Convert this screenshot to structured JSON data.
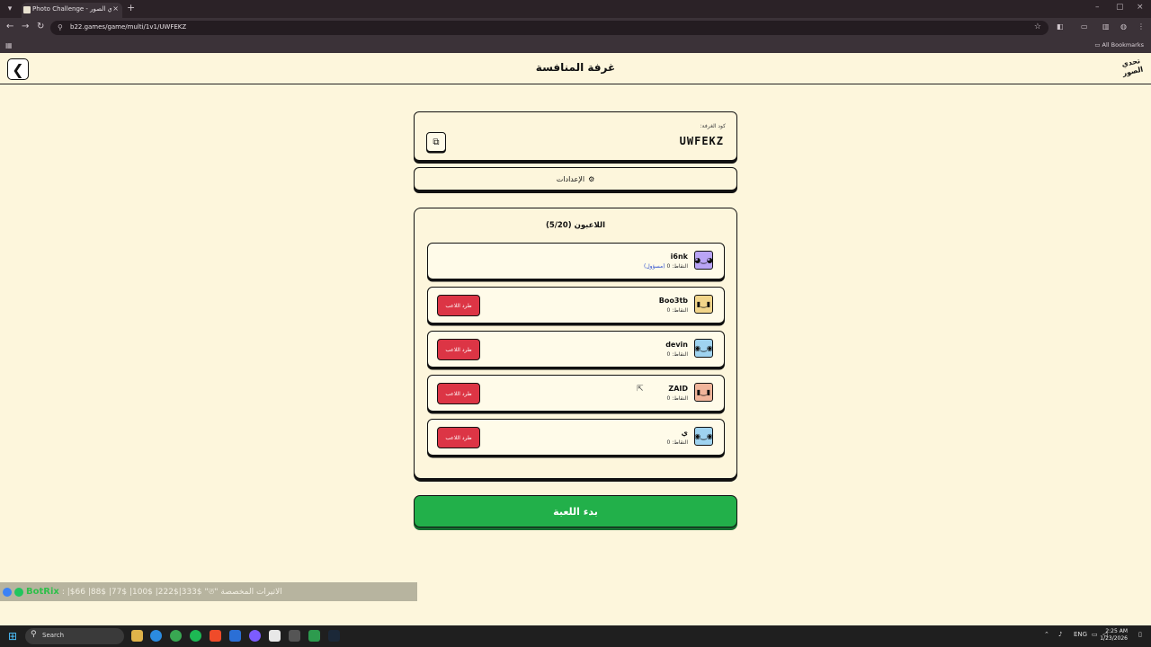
{
  "browser": {
    "tab_title": "Photo Challenge - تحدي الصور",
    "tab_close": "×",
    "new_tab": "+",
    "url": "b22.games/game/multi/1v1/UWFEKZ",
    "all_bookmarks": "All Bookmarks",
    "window_controls": {
      "minimize": "–",
      "maximize": "▢",
      "close": "×"
    }
  },
  "header": {
    "back_icon": "❮",
    "title": "غرفة المنافسة",
    "logo_text": "تحدي الصور"
  },
  "room": {
    "label": "كود الغرفة:",
    "code": "UWFEKZ",
    "copy_icon": "⧉"
  },
  "settings": {
    "label": "الإعدادات",
    "icon": "⚙"
  },
  "players": {
    "title": "اللاعبون (5/20)",
    "kick_label": "طرد اللاعب",
    "list": [
      {
        "name": "i6nk",
        "points": "النقاط: 0",
        "host": "(مسؤول)",
        "avatar_color": "#b9a4f5",
        "face": "◕‿◕"
      },
      {
        "name": "Boo3tb",
        "points": "النقاط: 0",
        "avatar_color": "#f2d58a",
        "face": "▮‿▮"
      },
      {
        "name": "devin",
        "points": "النقاط: 0",
        "avatar_color": "#9fd3f0",
        "face": "◉‿◉"
      },
      {
        "name": "ZAID",
        "points": "النقاط: 0",
        "avatar_color": "#f0b49a",
        "face": "▮‿▮"
      },
      {
        "name": "ي",
        "points": "النقاط: 0",
        "avatar_color": "#9fd3f0",
        "face": "◉‿◉"
      }
    ]
  },
  "start_button": "بدء اللعبة",
  "ticker": {
    "brand": "BotRix",
    "text": ": |$66 |88$ |77$ |100$ |222$|333$ \"ত\" الاتيرات المخصصة"
  },
  "taskbar": {
    "search_label": "Search",
    "language": "ENG",
    "time": "2:25 AM",
    "date": "1/23/2026"
  }
}
